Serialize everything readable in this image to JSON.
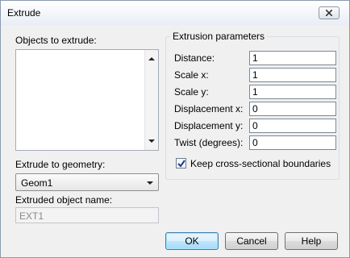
{
  "window": {
    "title": "Extrude",
    "close_icon": "close-icon"
  },
  "objects": {
    "label": "Objects to extrude:",
    "items": []
  },
  "geometry": {
    "label": "Extrude to geometry:",
    "selected": "Geom1"
  },
  "name_field": {
    "label": "Extruded object name:",
    "value": "EXT1"
  },
  "params": {
    "title": "Extrusion parameters",
    "fields": [
      {
        "label": "Distance:",
        "value": "1"
      },
      {
        "label": "Scale x:",
        "value": "1"
      },
      {
        "label": "Scale y:",
        "value": "1"
      },
      {
        "label": "Displacement x:",
        "value": "0"
      },
      {
        "label": "Displacement y:",
        "value": "0"
      },
      {
        "label": "Twist (degrees):",
        "value": "0"
      }
    ],
    "keep_boundaries": {
      "label": "Keep cross-sectional boundaries",
      "checked": true
    }
  },
  "buttons": {
    "ok": "OK",
    "cancel": "Cancel",
    "help": "Help"
  },
  "colors": {
    "default_button_border": "#3c7fb1",
    "frame": "#8a9aae"
  }
}
